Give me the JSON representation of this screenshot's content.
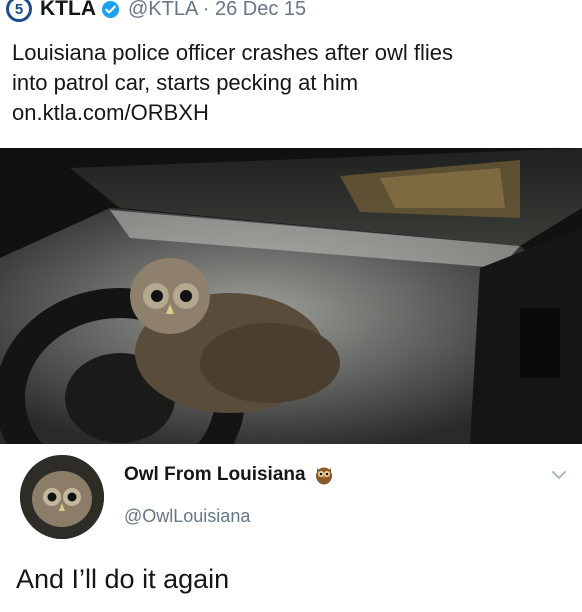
{
  "tweet": {
    "logo_text": "5",
    "display_name": "KTLA",
    "handle_date": "@KTLA · 26 Dec 15",
    "text_lines": [
      "Louisiana police officer crashes after owl flies",
      "into patrol car, starts pecking at him",
      "on.ktla.com/ORBXH"
    ]
  },
  "reply": {
    "display_name": "Owl From Louisiana",
    "handle": "@OwlLouisiana",
    "text": "And I’ll do it again"
  },
  "colors": {
    "text": "#14171a",
    "secondary": "#657786",
    "verified_blue": "#1da1f2",
    "ktla_blue": "#1d4b8f"
  }
}
